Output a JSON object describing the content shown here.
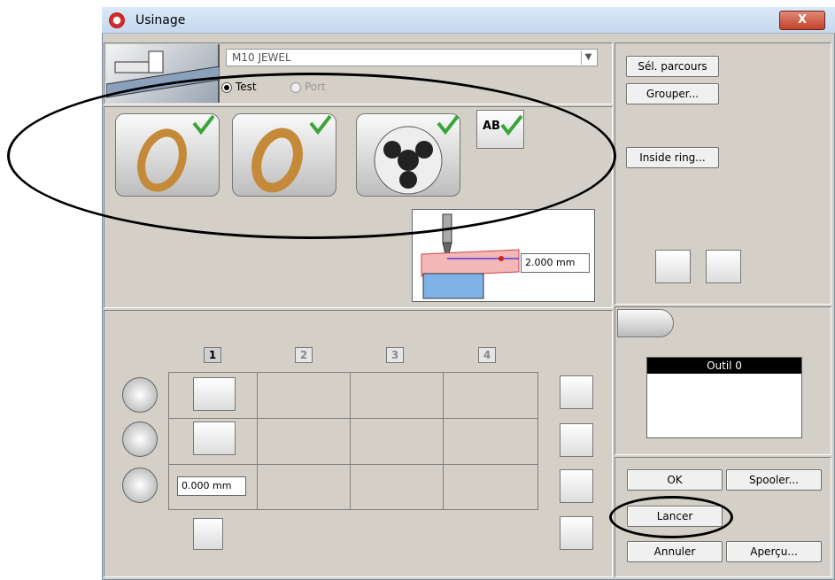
{
  "window": {
    "title": "Usinage",
    "close_label": "X"
  },
  "machine": {
    "selected": "M10 JEWEL",
    "mode_test": "Test",
    "mode_port": "Port"
  },
  "right_buttons": {
    "sel_parcours": "Sél. parcours",
    "grouper": "Grouper...",
    "inside_ring": "Inside ring..."
  },
  "depth": {
    "value": "2.000 mm"
  },
  "passes": {
    "numbers": [
      "1",
      "2",
      "3",
      "4"
    ],
    "offset_value": "0.000 mm"
  },
  "tools": {
    "list": [
      "Outil 0"
    ]
  },
  "bottom_buttons": {
    "ok": "OK",
    "spooler": "Spooler...",
    "lancer": "Lancer",
    "annuler": "Annuler",
    "apercu": "Aperçu..."
  },
  "icons": {
    "ab_label": "AB"
  },
  "colors": {
    "highlight": "#000000",
    "check": "#3aa53a",
    "red": "#cc2222"
  }
}
